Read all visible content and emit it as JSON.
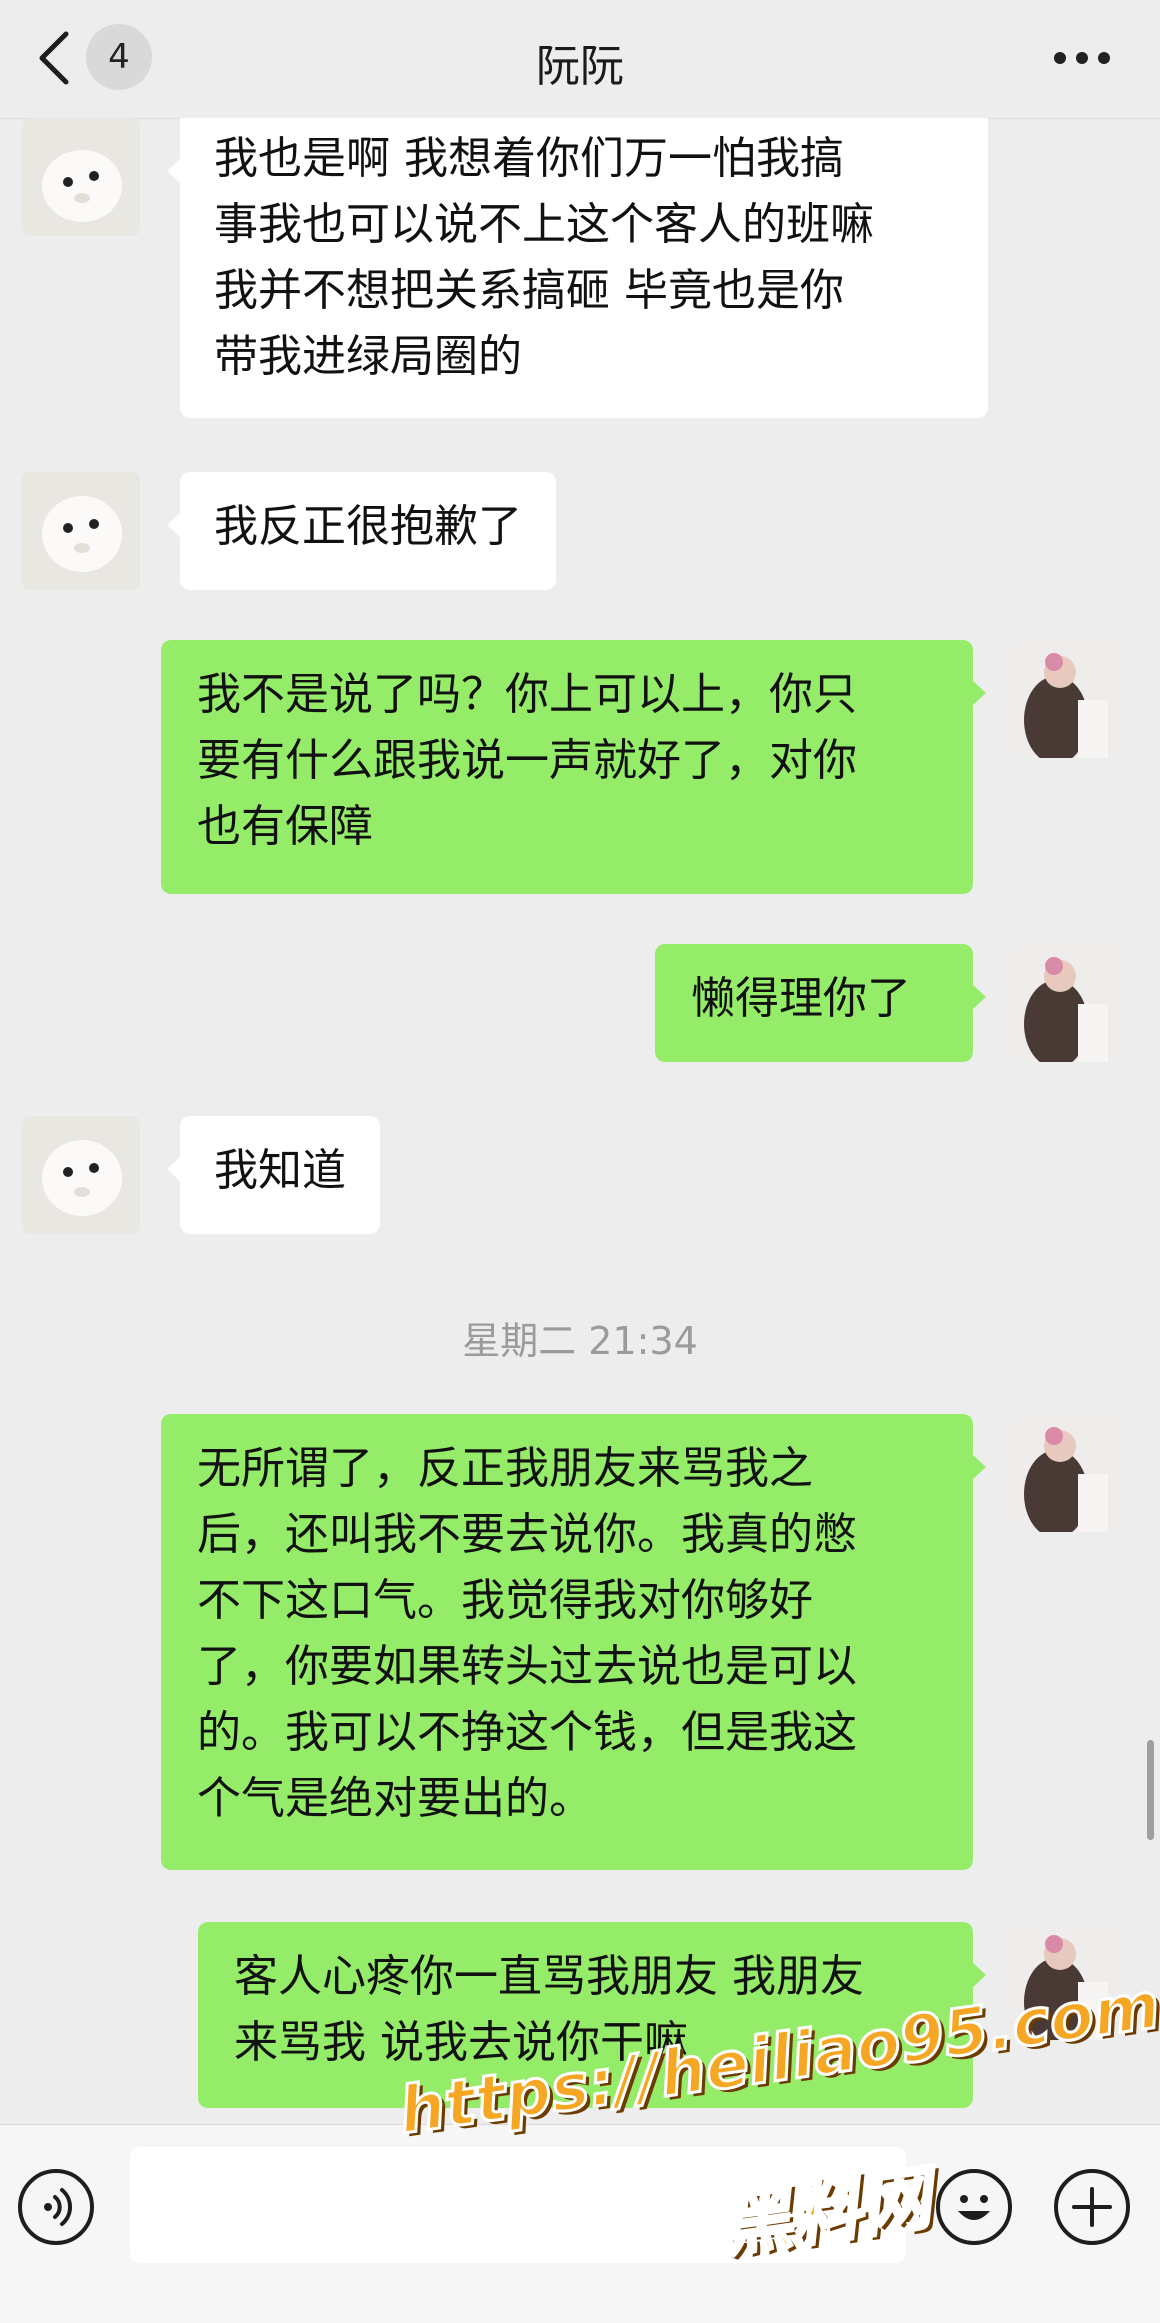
{
  "header": {
    "back_icon": "chevron-left-icon",
    "unread_count": "4",
    "title": "阮阮",
    "more_icon": "more-dots-icon"
  },
  "messages": [
    {
      "side": "left",
      "text": "我也是啊 我想着你们万一怕我搞\n事我也可以说不上这个客人的班嘛\n我并不想把关系搞砸 毕竟也是你\n带我进绿局圈的"
    },
    {
      "side": "left",
      "text": "我反正很抱歉了"
    },
    {
      "side": "right",
      "text": "我不是说了吗？你上可以上，你只\n要有什么跟我说一声就好了，对你\n也有保障"
    },
    {
      "side": "right",
      "text": "懒得理你了"
    },
    {
      "side": "left",
      "text": "我知道"
    },
    {
      "side": "right",
      "text": "无所谓了，反正我朋友来骂我之\n后，还叫我不要去说你。我真的憋\n不下这口气。我觉得我对你够好\n了，你要如果转头过去说也是可以\n的。我可以不挣这个钱，但是我这\n个气是绝对要出的。"
    },
    {
      "side": "right",
      "text": "客人心疼你一直骂我朋友 我朋友\n来骂我 说我去说你干嘛"
    }
  ],
  "timestamp": "星期二 21:34",
  "input_bar": {
    "voice_icon": "voice-icon",
    "input_value": "",
    "emoji_icon": "emoji-icon",
    "plus_icon": "plus-icon"
  },
  "watermark": {
    "url": "https://heiliao95.com",
    "name": "黑料网"
  },
  "colors": {
    "background": "#ededed",
    "sent_bubble": "#95ec69",
    "received_bubble": "#ffffff",
    "watermark": "#f5a623"
  }
}
